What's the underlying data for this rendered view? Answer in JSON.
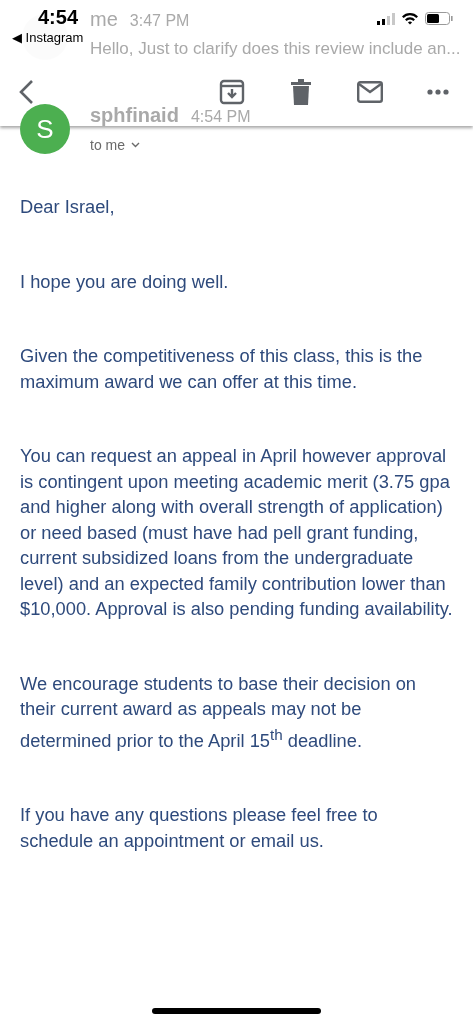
{
  "status_bar": {
    "time": "4:54",
    "back_app": "◀ Instagram"
  },
  "previous_message": {
    "sender": "me",
    "time": "3:47 PM",
    "preview": "Hello, Just to clarify does this review include an..."
  },
  "message": {
    "sender": "sphfinaid",
    "time": "4:54 PM",
    "avatar_letter": "S",
    "recipient": "to me",
    "paragraphs": [
      "Dear Israel,",
      "I hope you are doing well.",
      "Given the competitiveness of this class, this is the maximum award we can offer at this time.",
      "You can request an appeal in April however approval is contingent upon meeting academic merit (3.75 gpa and higher along with overall strength of application) or need based (must have had pell grant funding, current subsidized loans from the undergraduate level) and an expected family contribution lower than $10,000. Approval is also pending funding availability.",
      "We encourage students to base their decision on their current award as appeals may not be determined prior to the April 15$^{th}$ deadline.",
      "If you have any questions please feel free to schedule an appointment or email us."
    ]
  }
}
